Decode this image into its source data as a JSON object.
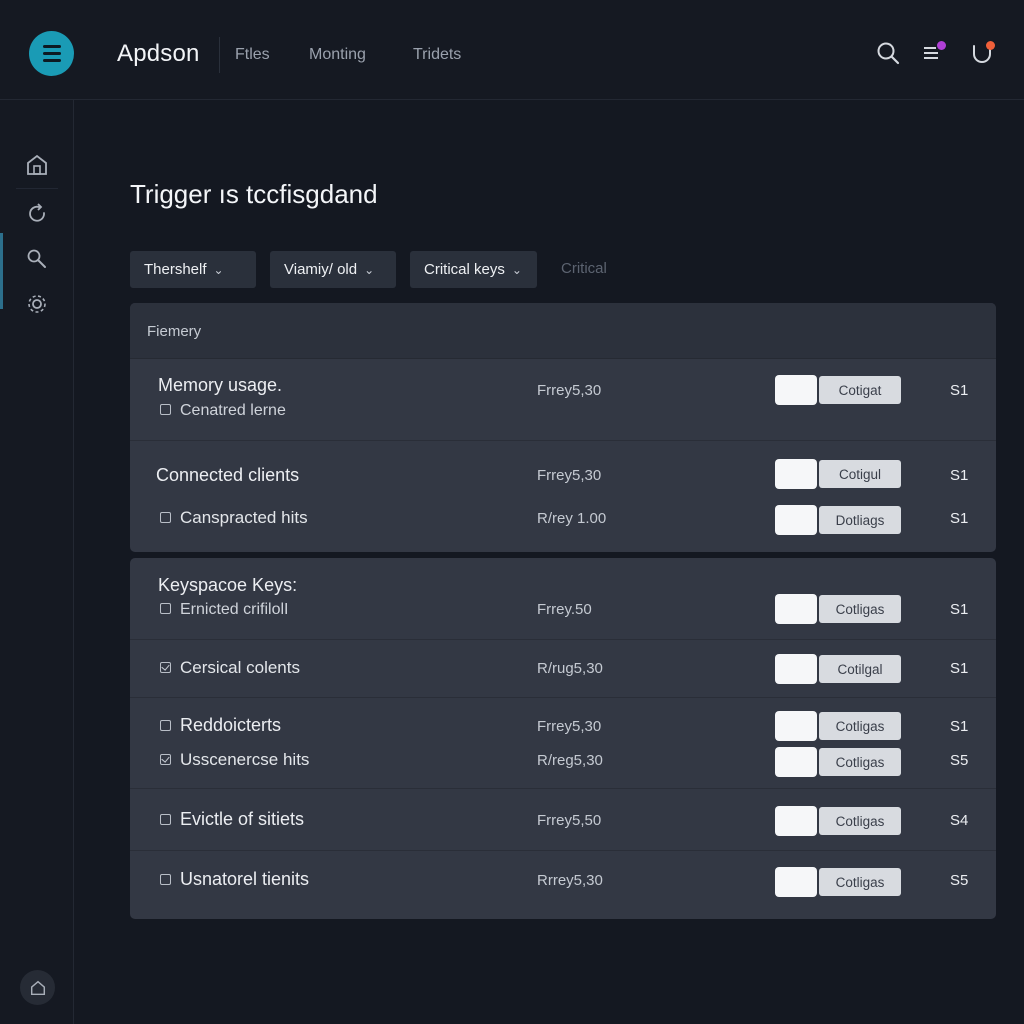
{
  "header": {
    "app_title": "Apdson",
    "tabs": [
      "Ftles",
      "Monting",
      "Tridets"
    ]
  },
  "icons": {
    "menu": "hamburger-menu-icon",
    "search": "search-icon",
    "list": "list-icon",
    "profile": "user-icon"
  },
  "colors": {
    "accent": "#1a9bb5",
    "notify_purple": "#b03fd6",
    "notify_orange": "#f0603a"
  },
  "main": {
    "title": "Trigger ıs tccfisgdand",
    "filters": [
      "Thershelf",
      "Viamiy/ old",
      "Critical keys"
    ],
    "filter_plain": "Critical"
  },
  "panel1": {
    "header": "Fiemery",
    "rows": [
      {
        "label": "Memory usage.",
        "sub": "Cenatred lerne",
        "freq": "Frrey5,30",
        "action": "Cotigat",
        "num": "S1"
      },
      {
        "label": "Connected clients",
        "freq": "Frrey5,30",
        "action": "Cotigul",
        "num": "S1"
      },
      {
        "label": "Canspracted hits",
        "freq": "R/rey 1.00",
        "action": "Dotliags",
        "num": "S1"
      }
    ]
  },
  "panel2": {
    "rows": [
      {
        "label": "Keyspacoe Keys:",
        "sub": "Ernicted crifilolI",
        "freq": "Frrey.50",
        "action": "Cotligas",
        "num": "S1"
      },
      {
        "label": "Cersical colents",
        "freq": "R/rug5,30",
        "action": "Cotilgal",
        "num": "S1"
      },
      {
        "label": "Reddoicterts",
        "freq": "Frrey5,30",
        "action": "Cotligas",
        "num": "S1"
      },
      {
        "label": "Usscenercse hits",
        "freq": "R/reg5,30",
        "action": "Cotligas",
        "num": "S5"
      },
      {
        "label": "Evictle of sitiets",
        "freq": "Frrey5,50",
        "action": "Cotligas",
        "num": "S4"
      },
      {
        "label": "Usnatorel tienits",
        "freq": "Rrrey5,30",
        "action": "Cotligas",
        "num": "S5"
      }
    ]
  }
}
